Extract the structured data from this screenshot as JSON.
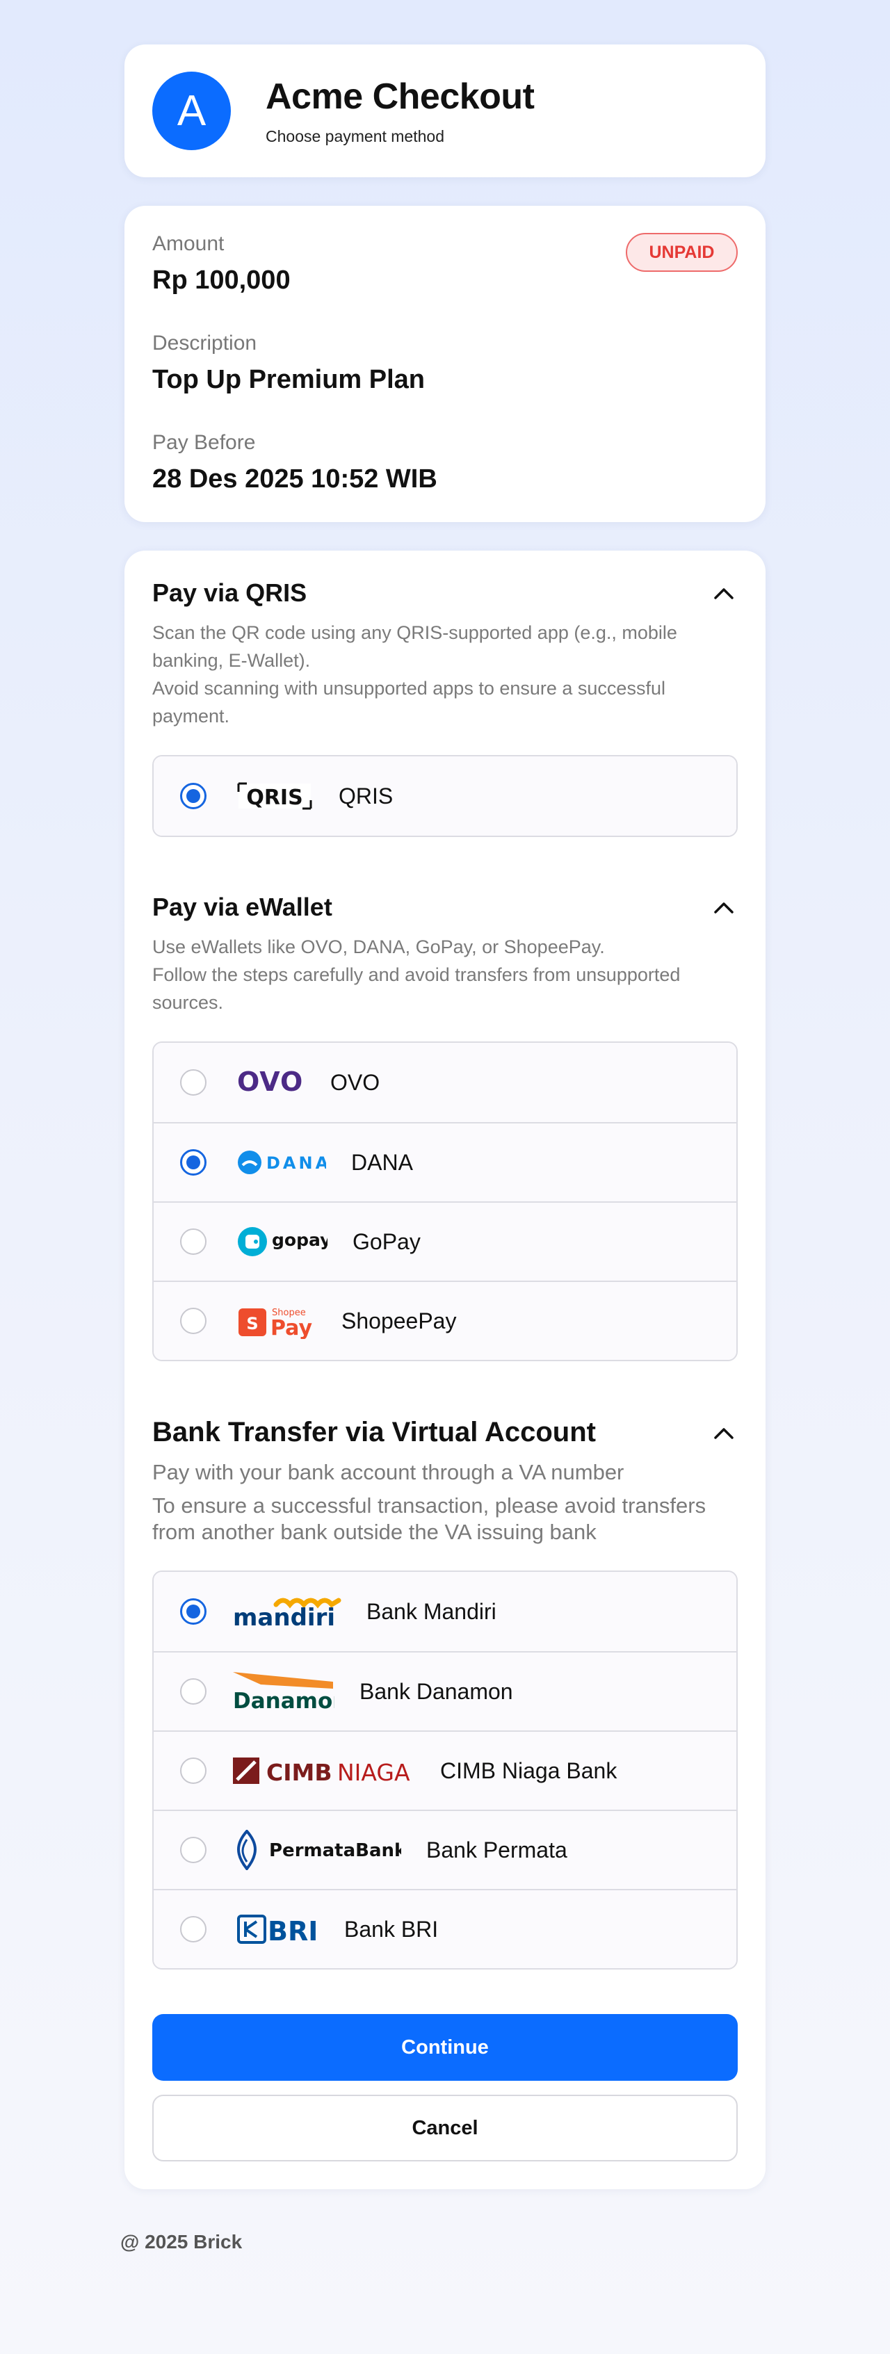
{
  "header": {
    "avatar_letter": "A",
    "title": "Acme Checkout",
    "subtitle": "Choose payment method"
  },
  "summary": {
    "status_badge": "UNPAID",
    "amount_label": "Amount",
    "amount_value": "Rp 100,000",
    "description_label": "Description",
    "description_value": "Top Up Premium Plan",
    "pay_before_label": "Pay Before",
    "pay_before_value": "28 Des 2025 10:52 WIB"
  },
  "qris": {
    "title": "Pay via QRIS",
    "desc1": "Scan the QR code using any QRIS-supported app (e.g., mobile banking, E-Wallet).",
    "desc2": "Avoid scanning with unsupported apps to ensure a successful payment.",
    "logo_text": "QRIS",
    "options": [
      {
        "label": "QRIS",
        "selected": true,
        "icon": "qris-logo"
      }
    ]
  },
  "ewallet": {
    "title": "Pay via eWallet",
    "desc1": "Use eWallets like OVO, DANA, GoPay, or ShopeePay.",
    "desc2": "Follow the steps carefully and avoid transfers from unsupported sources.",
    "logos": {
      "ovo": "OVO",
      "dana": "DANA",
      "gopay": "gopay",
      "shopee_top": "Shopee",
      "shopee_bottom": "Pay"
    },
    "options": [
      {
        "label": "OVO",
        "selected": false,
        "icon": "ovo-logo"
      },
      {
        "label": "DANA",
        "selected": true,
        "icon": "dana-logo"
      },
      {
        "label": "GoPay",
        "selected": false,
        "icon": "gopay-logo"
      },
      {
        "label": "ShopeePay",
        "selected": false,
        "icon": "shopeepay-logo"
      }
    ]
  },
  "bank": {
    "title": "Bank Transfer via Virtual Account",
    "desc1": "Pay with your bank account through a VA number",
    "desc2": "To ensure a successful transaction, please avoid transfers from another bank outside the VA issuing bank",
    "logos": {
      "mandiri": "mandiri",
      "danamon": "Danamon",
      "cimb": "CIMB",
      "niaga": "NIAGA",
      "permata": "PermataBank",
      "bri": "BRI"
    },
    "options": [
      {
        "label": "Bank Mandiri",
        "selected": true,
        "icon": "mandiri-logo"
      },
      {
        "label": "Bank Danamon",
        "selected": false,
        "icon": "danamon-logo"
      },
      {
        "label": "CIMB Niaga Bank",
        "selected": false,
        "icon": "cimb-niaga-logo"
      },
      {
        "label": "Bank Permata",
        "selected": false,
        "icon": "permata-logo"
      },
      {
        "label": "Bank BRI",
        "selected": false,
        "icon": "bri-logo"
      }
    ]
  },
  "actions": {
    "continue_label": "Continue",
    "cancel_label": "Cancel"
  },
  "footer": {
    "text": "@ 2025 Brick"
  },
  "colors": {
    "primary": "#0b6cff",
    "radio_selected": "#1565e0",
    "unpaid_red": "#e53935",
    "ovo_purple": "#4c2a86",
    "dana_blue": "#118eea",
    "gopay_teal": "#00aed6",
    "shopee_orange": "#ee4d2d",
    "mandiri_navy": "#003d79",
    "mandiri_gold": "#f5a800",
    "danamon_orange": "#f28c28",
    "danamon_green": "#004d40",
    "cimb_red": "#7b1c1c",
    "permata_blue": "#0e4a9e",
    "bri_blue": "#00529c"
  }
}
